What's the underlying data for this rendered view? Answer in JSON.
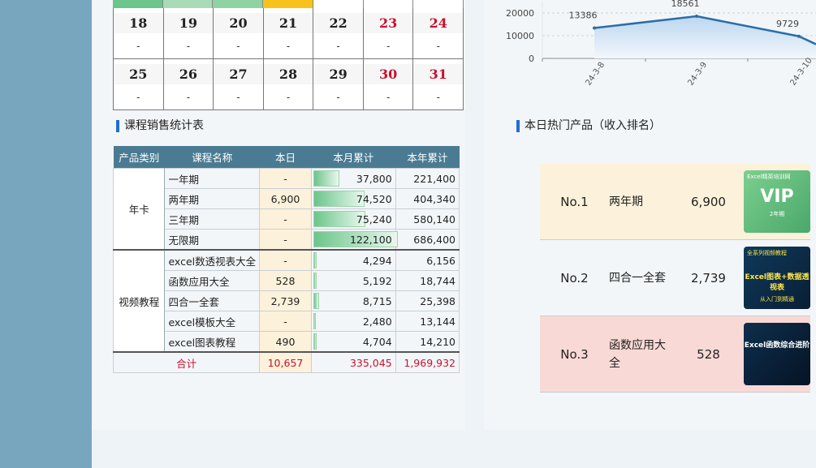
{
  "calendar": {
    "rows": [
      {
        "days": [
          {
            "day": "18",
            "val": "-",
            "red": false
          },
          {
            "day": "19",
            "val": "-",
            "red": false
          },
          {
            "day": "20",
            "val": "-",
            "red": false
          },
          {
            "day": "21",
            "val": "-",
            "red": false
          },
          {
            "day": "22",
            "val": "-",
            "red": false
          },
          {
            "day": "23",
            "val": "-",
            "red": true
          },
          {
            "day": "24",
            "val": "-",
            "red": true
          }
        ]
      },
      {
        "days": [
          {
            "day": "25",
            "val": "-",
            "red": false
          },
          {
            "day": "26",
            "val": "-",
            "red": false
          },
          {
            "day": "27",
            "val": "-",
            "red": false
          },
          {
            "day": "28",
            "val": "-",
            "red": false
          },
          {
            "day": "29",
            "val": "-",
            "red": false
          },
          {
            "day": "30",
            "val": "-",
            "red": true
          },
          {
            "day": "31",
            "val": "-",
            "red": true
          }
        ]
      }
    ],
    "top_colors": [
      "#6cc58b",
      "#a8dbb6",
      "#8fd3a2",
      "#f7c21c",
      "#ffffff",
      "#ffffff",
      "#ffffff"
    ]
  },
  "sales": {
    "title": "课程销售统计表",
    "headers": [
      "产品类别",
      "课程名称",
      "本日",
      "本月累计",
      "本年累计"
    ],
    "groups": [
      {
        "category": "年卡",
        "rows": [
          {
            "name": "一年期",
            "today": "-",
            "month": "37,800",
            "month_num": 37800,
            "year": "221,400"
          },
          {
            "name": "两年期",
            "today": "6,900",
            "month": "74,520",
            "month_num": 74520,
            "year": "404,340"
          },
          {
            "name": "三年期",
            "today": "-",
            "month": "75,240",
            "month_num": 75240,
            "year": "580,140"
          },
          {
            "name": "无限期",
            "today": "-",
            "month": "122,100",
            "month_num": 122100,
            "year": "686,400"
          }
        ]
      },
      {
        "category": "视频教程",
        "rows": [
          {
            "name": "excel数透视表大全",
            "today": "-",
            "month": "4,294",
            "month_num": 4294,
            "year": "6,156"
          },
          {
            "name": "函数应用大全",
            "today": "528",
            "month": "5,192",
            "month_num": 5192,
            "year": "18,744"
          },
          {
            "name": "四合一全套",
            "today": "2,739",
            "month": "8,715",
            "month_num": 8715,
            "year": "25,398"
          },
          {
            "name": "excel模板大全",
            "today": "-",
            "month": "2,480",
            "month_num": 2480,
            "year": "13,144"
          },
          {
            "name": "excel图表教程",
            "today": "490",
            "month": "4,704",
            "month_num": 4704,
            "year": "14,210"
          }
        ]
      }
    ],
    "total": {
      "label": "合计",
      "today": "10,657",
      "month": "335,045",
      "year": "1,969,932"
    }
  },
  "chart_data": {
    "type": "area",
    "categories": [
      "24-3-8",
      "24-3-9",
      "24-3-10"
    ],
    "values": [
      13386,
      18561,
      9729
    ],
    "value_labels": [
      "13386",
      "18561",
      "9729"
    ],
    "y_ticks": [
      "0",
      "10000",
      "20000"
    ],
    "ylim": [
      0,
      25000
    ],
    "grid": true,
    "color": "#2a6ea8"
  },
  "hot": {
    "title": "本日热门产品（收入排名）",
    "items": [
      {
        "rank": "No.1",
        "name": "两年期",
        "value": "6,900",
        "bg": "#fcf1da",
        "img_text": "VIP",
        "img_sub": "2年期",
        "img_top": "Excel精英培训网"
      },
      {
        "rank": "No.2",
        "name": "四合一全套",
        "value": "2,739",
        "bg": "#f3f6f9",
        "img_text": "Excel图表+数据透视表",
        "img_sub": "从入门到精通",
        "img_top": "全系列视频教程"
      },
      {
        "rank": "No.3",
        "name": "函数应用大全",
        "value": "528",
        "bg": "#f9d9d6",
        "img_text": "Excel函数综合进阶",
        "img_sub": "",
        "img_top": ""
      }
    ]
  }
}
